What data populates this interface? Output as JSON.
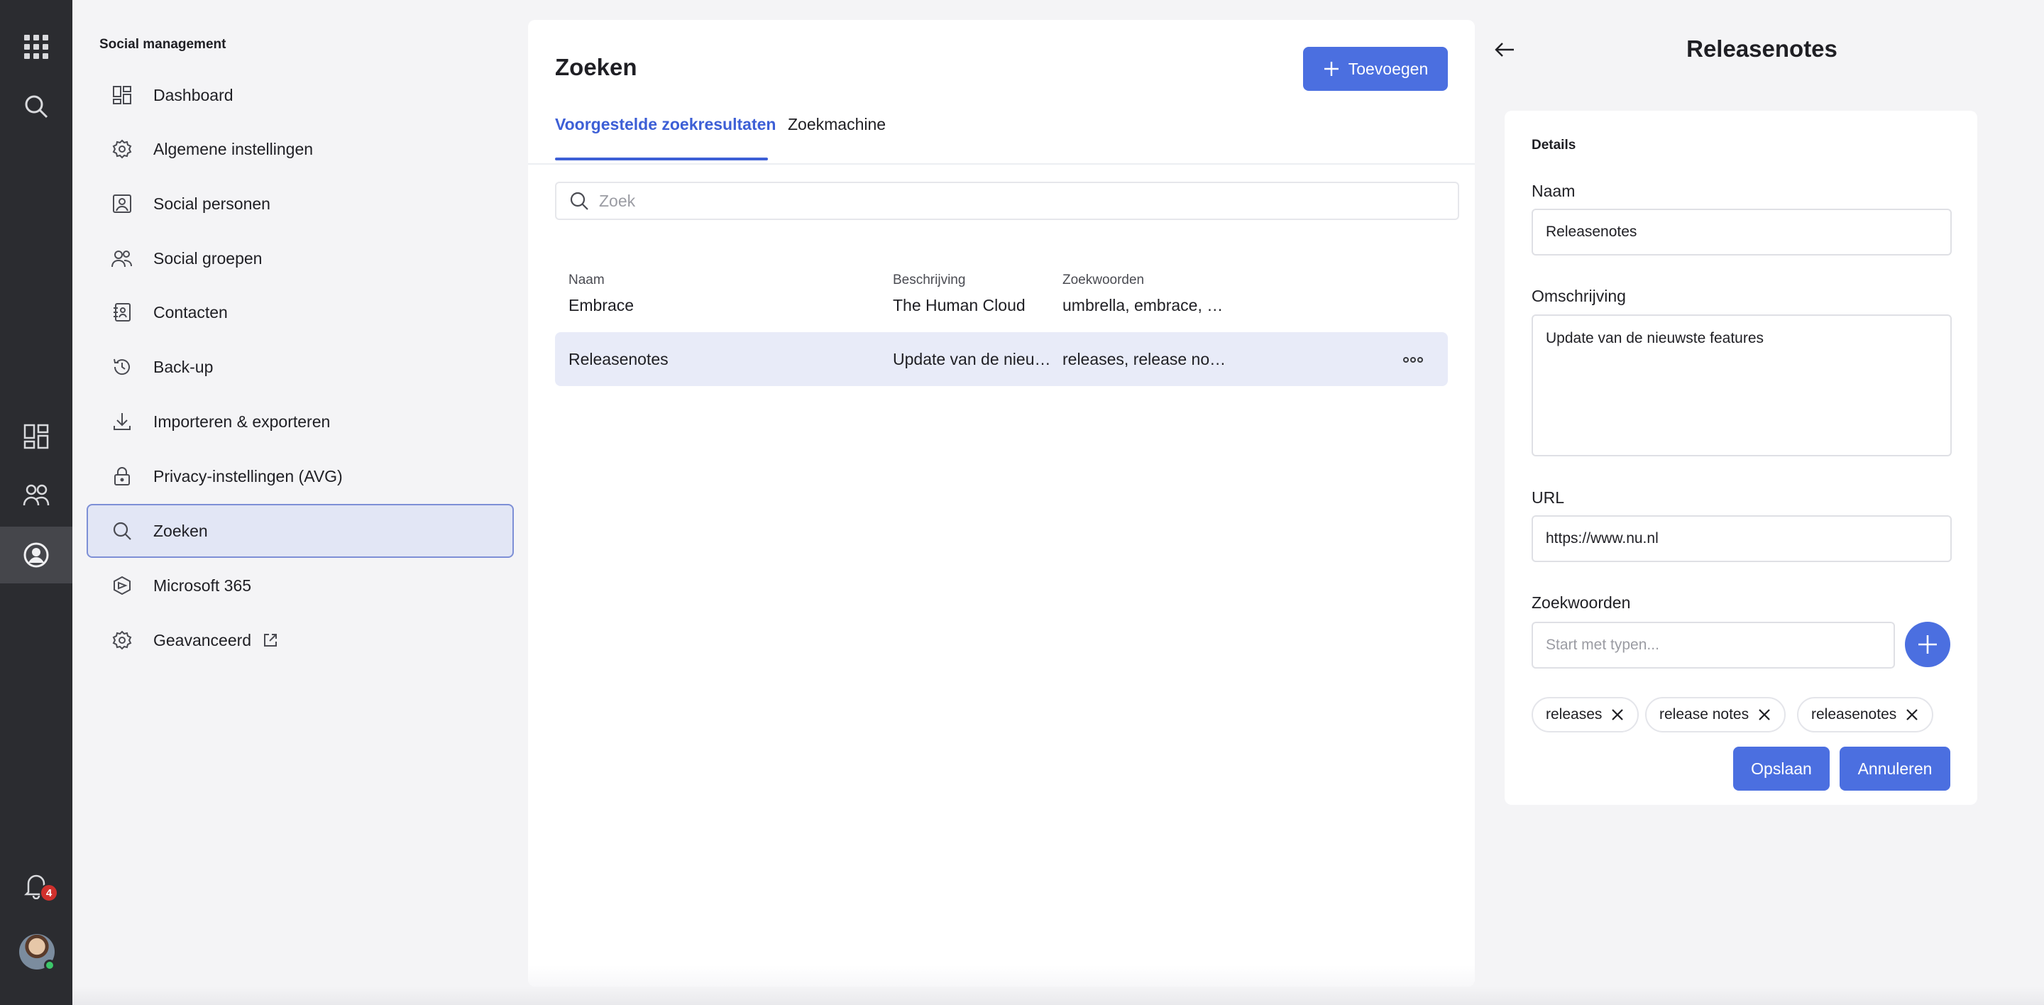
{
  "rail": {
    "notification_count": "4",
    "items": [
      "apps-icon",
      "search-icon",
      "dashboard-icon",
      "people-icon",
      "social-icon",
      "bell-icon"
    ]
  },
  "sidebar": {
    "heading": "Social management",
    "items": [
      {
        "label": "Dashboard",
        "icon": "dashboard-icon"
      },
      {
        "label": "Algemene instellingen",
        "icon": "gear-icon"
      },
      {
        "label": "Social personen",
        "icon": "person-card-icon"
      },
      {
        "label": "Social groepen",
        "icon": "group-icon"
      },
      {
        "label": "Contacten",
        "icon": "contacts-icon"
      },
      {
        "label": "Back-up",
        "icon": "history-icon"
      },
      {
        "label": "Importeren & exporteren",
        "icon": "download-icon"
      },
      {
        "label": "Privacy-instellingen (AVG)",
        "icon": "lock-icon"
      },
      {
        "label": "Zoeken",
        "icon": "search-icon",
        "active": true
      },
      {
        "label": "Microsoft 365",
        "icon": "hexagon-icon"
      },
      {
        "label": "Geavanceerd",
        "icon": "gear-icon"
      }
    ]
  },
  "main": {
    "title": "Zoeken",
    "add_label": "Toevoegen",
    "tabs": [
      {
        "label": "Voorgestelde zoekresultaten",
        "active": true
      },
      {
        "label": "Zoekmachine",
        "active": false
      }
    ],
    "search_placeholder": "Zoek",
    "columns": [
      "Naam",
      "Beschrijving",
      "Zoekwoorden"
    ],
    "rows": [
      {
        "name": "Embrace",
        "description": "The Human Cloud",
        "keywords": "umbrella, embrace, m..."
      },
      {
        "name": "Releasenotes",
        "description": "Update van de nieuwste features",
        "keywords": "releases, release notes, releasenotes",
        "selected": true
      }
    ]
  },
  "detail": {
    "title": "Releasenotes",
    "section": "Details",
    "name_label": "Naam",
    "name_value": "Releasenotes",
    "description_label": "Omschrijving",
    "description_value": "Update van de nieuwste features",
    "url_label": "URL",
    "url_value": "https://www.nu.nl",
    "keywords_label": "Zoekwoorden",
    "keywords_placeholder": "Start met typen...",
    "chips": [
      "releases",
      "release notes",
      "releasenotes"
    ],
    "save_label": "Opslaan",
    "cancel_label": "Annuleren"
  },
  "colors": {
    "accent": "#4b6fe0",
    "rail": "#2b2c30",
    "selected_row": "#e8ebf8",
    "badge": "#d0312d"
  }
}
